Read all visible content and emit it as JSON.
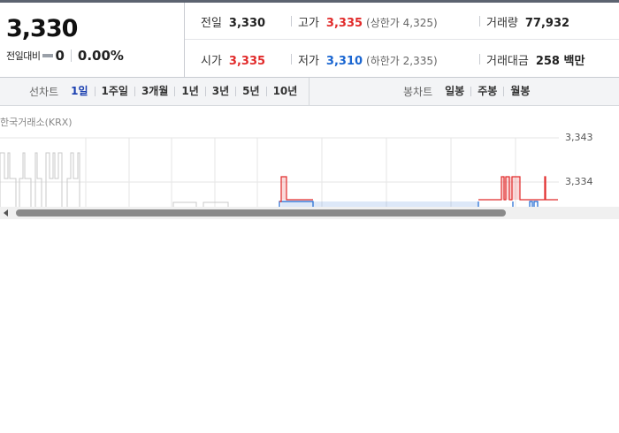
{
  "summary": {
    "current_price": "3,330",
    "change_label": "전일대비",
    "change_value": "0",
    "change_rate": "0.00%",
    "rows": [
      [
        {
          "label": "전일",
          "value": "3,330",
          "tone": "normal",
          "sub": ""
        },
        {
          "label": "고가",
          "value": "3,335",
          "tone": "up",
          "sub": "(상한가 4,325)"
        },
        {
          "label": "거래량",
          "value": "77,932",
          "tone": "normal",
          "sub": ""
        }
      ],
      [
        {
          "label": "시가",
          "value": "3,335",
          "tone": "up",
          "sub": ""
        },
        {
          "label": "저가",
          "value": "3,310",
          "tone": "down",
          "sub": "(하한가 2,335)"
        },
        {
          "label": "거래대금",
          "value": "258 백만",
          "tone": "normal",
          "sub": ""
        }
      ]
    ]
  },
  "toolbar": {
    "line_chart_label": "선차트",
    "line_periods": [
      "1일",
      "1주일",
      "3개월",
      "1년",
      "3년",
      "5년",
      "10년"
    ],
    "active_period": "1일",
    "candle_chart_label": "봉차트",
    "candle_periods": [
      "일봉",
      "주봉",
      "월봉"
    ]
  },
  "chart": {
    "source": "한국거래소(KRX)",
    "y_ticks": [
      "3,343",
      "3,334"
    ],
    "colors": {
      "up": "#e12b2b",
      "down": "#1a66d1",
      "grid": "#e6e6e6",
      "ghost": "#c8c8c8"
    }
  },
  "scrollbar": {
    "arrow_icon": "scroll-left-arrow-icon"
  }
}
